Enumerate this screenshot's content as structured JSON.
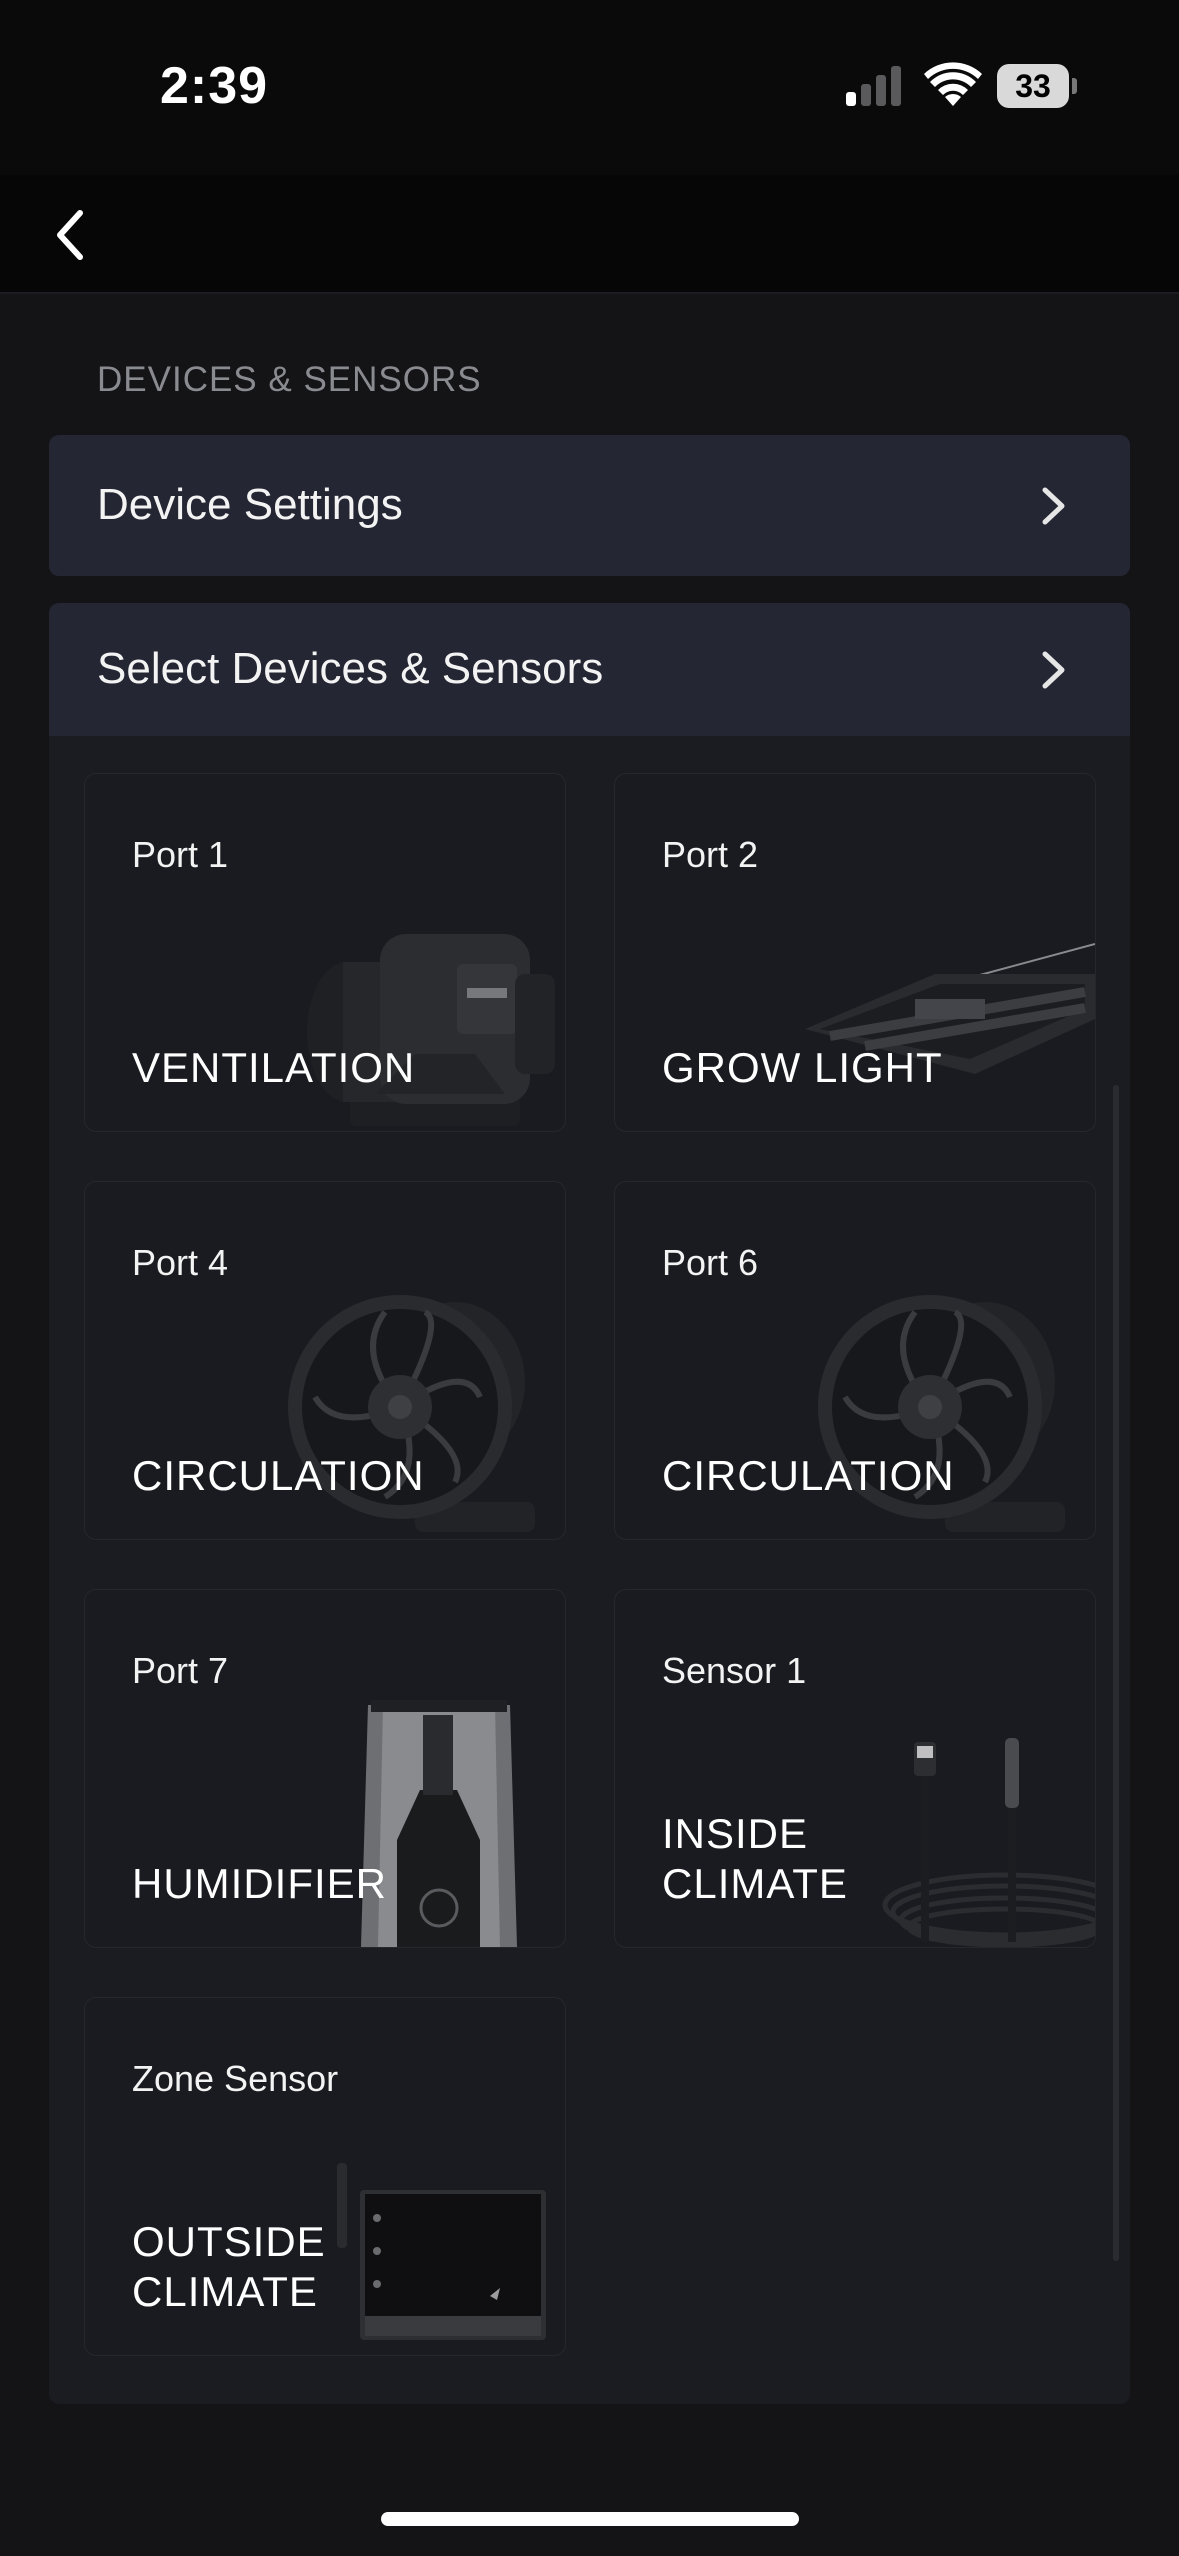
{
  "status_bar": {
    "time": "2:39",
    "battery_level": "33",
    "signal_icon": "cellular-signal-icon",
    "wifi_icon": "wifi-icon",
    "battery_icon": "battery-icon"
  },
  "nav": {
    "back_icon": "chevron-left-icon"
  },
  "section": {
    "header": "DEVICES & SENSORS"
  },
  "rows": {
    "device_settings": "Device Settings",
    "select_devices": "Select Devices & Sensors",
    "chevron_icon": "chevron-right-icon"
  },
  "cards": [
    {
      "port": "Port 1",
      "type": "VENTILATION",
      "image": "inline-duct-fan-image"
    },
    {
      "port": "Port 2",
      "type": "GROW LIGHT",
      "image": "grow-light-image"
    },
    {
      "port": "Port 4",
      "type": "CIRCULATION",
      "image": "clip-fan-image"
    },
    {
      "port": "Port 6",
      "type": "CIRCULATION",
      "image": "clip-fan-image"
    },
    {
      "port": "Port 7",
      "type": "HUMIDIFIER",
      "image": "humidifier-image"
    },
    {
      "port": "Sensor 1",
      "type": "INSIDE\nCLIMATE",
      "image": "sensor-probe-image"
    },
    {
      "port": "Zone Sensor",
      "type": "OUTSIDE\nCLIMATE",
      "image": "zone-sensor-image"
    }
  ],
  "colors": {
    "background": "#0a0a0b",
    "content": "#141416",
    "row": "#242633",
    "card": "#1a1b20",
    "text": "#ffffff",
    "muted": "#8a8b90"
  }
}
